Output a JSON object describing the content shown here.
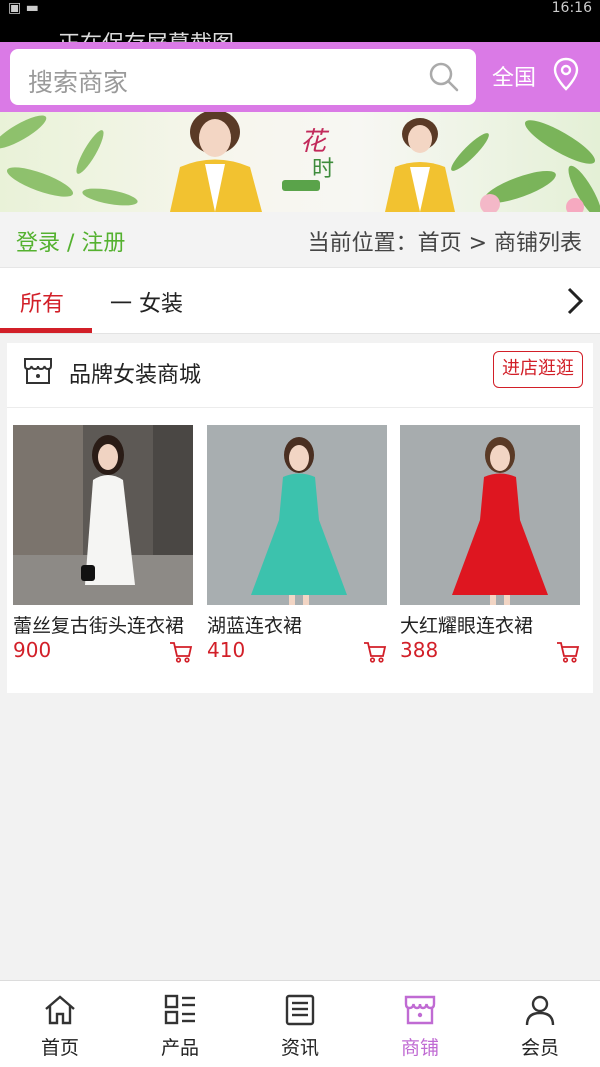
{
  "status_bar": {
    "ghost_text": "正在保存屏幕截图",
    "time": "16:16"
  },
  "search": {
    "placeholder": "搜索商家"
  },
  "region": {
    "label": "全国"
  },
  "breadcrumb": {
    "login_link": "登录 / 注册",
    "location": "当前位置：首页 > 商铺列表"
  },
  "tabs": [
    {
      "label": "所有",
      "active": true
    },
    {
      "label": "一 女装",
      "active": false
    }
  ],
  "shop": {
    "name": "品牌女装商城",
    "enter_label": "进店逛逛",
    "products": [
      {
        "name": "蕾丝复古街头连衣裙",
        "price": "900"
      },
      {
        "name": "湖蓝连衣裙",
        "price": "410"
      },
      {
        "name": "大红耀眼连衣裙",
        "price": "388"
      }
    ]
  },
  "bottom_nav": [
    {
      "label": "首页",
      "icon": "home-icon",
      "active": false
    },
    {
      "label": "产品",
      "icon": "grid-list-icon",
      "active": false
    },
    {
      "label": "资讯",
      "icon": "news-icon",
      "active": false
    },
    {
      "label": "商铺",
      "icon": "store-icon",
      "active": true
    },
    {
      "label": "会员",
      "icon": "user-icon",
      "active": false
    }
  ],
  "colors": {
    "accent": "#da7ae6",
    "red": "#d21f28",
    "green": "#54b12f",
    "nav_active": "#c06bd3"
  }
}
